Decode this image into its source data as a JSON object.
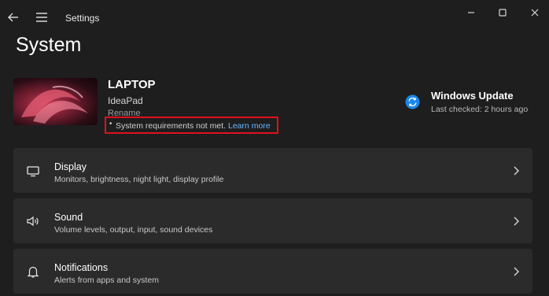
{
  "window": {
    "title": "Settings",
    "controls": [
      "minimize-icon",
      "maximize-icon",
      "close-icon"
    ]
  },
  "page": {
    "title": "System"
  },
  "device": {
    "name": "LAPTOP",
    "model": "IdeaPad",
    "rename": "Rename",
    "requirements_text": "System requirements not met.",
    "requirements_link": "Learn more"
  },
  "windows_update": {
    "title": "Windows Update",
    "last_checked": "Last checked: 2 hours ago",
    "icon": "sync-icon",
    "accent": "#1a86e8"
  },
  "cards": [
    {
      "title": "Display",
      "subtitle": "Monitors, brightness, night light, display profile",
      "icon": "monitor-icon"
    },
    {
      "title": "Sound",
      "subtitle": "Volume levels, output, input, sound devices",
      "icon": "speaker-icon"
    },
    {
      "title": "Notifications",
      "subtitle": "Alerts from apps and system",
      "icon": "bell-icon"
    }
  ],
  "colors": {
    "background": "#1e1e1e",
    "card": "#2b2b2b",
    "highlight_box": "#e01020",
    "link": "#6ab7ff"
  }
}
